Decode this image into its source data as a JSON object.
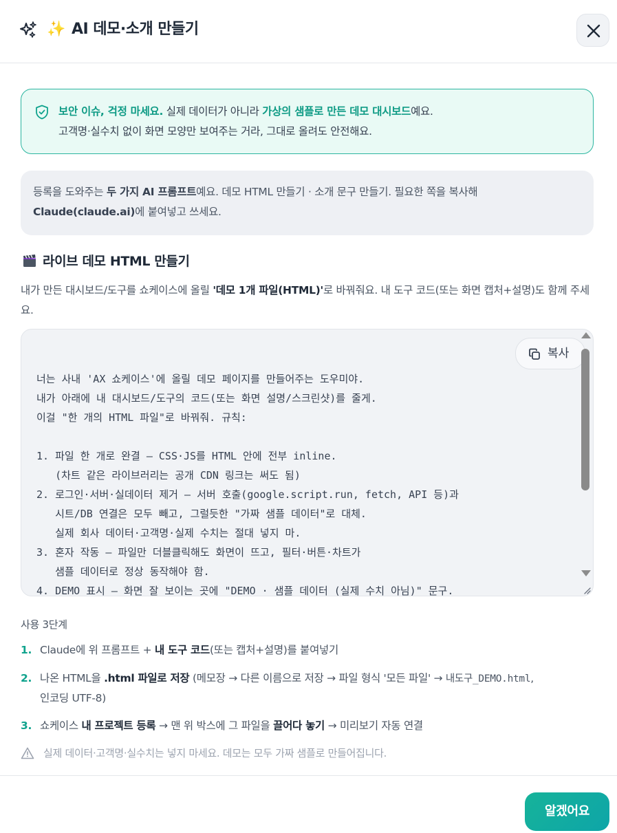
{
  "header": {
    "title": "AI 데모·소개 만들기",
    "emoji": "✨"
  },
  "notice": {
    "bold1": "보안 이슈, 걱정 마세요.",
    "text1": " 실제 데이터가 아니라 ",
    "bold2": "가상의 샘플로 만든 데모 대시보드",
    "text2": "예요.",
    "line2": "고객명·실수치 없이 화면 모양만 보여주는 거라, 그대로 올려도 안전해요."
  },
  "info": {
    "t1": "등록을 도와주는 ",
    "b1": "두 가지 AI 프롬프트",
    "t2": "예요. 데모 HTML 만들기 · 소개 문구 만들기. 필요한 쪽을 복사해",
    "b2": "Claude(claude.ai)",
    "t3": "에 붙여넣고 쓰세요."
  },
  "section": {
    "title": "라이브 데모 HTML 만들기",
    "desc_t1": "내가 만든 대시보드/도구를 쇼케이스에 올릴 ",
    "desc_b1": "'데모 1개 파일(HTML)'",
    "desc_t2": "로 바꿔줘요. 내 도구 코드(또는 화면 캡처+설명)도 함께 주세요."
  },
  "code": {
    "copy_label": "복사",
    "prompt": "너는 사내 'AX 쇼케이스'에 올릴 데모 페이지를 만들어주는 도우미야.\n내가 아래에 내 대시보드/도구의 코드(또는 화면 설명/스크린샷)를 줄게.\n이걸 \"한 개의 HTML 파일\"로 바꿔줘. 규칙:\n\n1. 파일 한 개로 완결 — CSS·JS를 HTML 안에 전부 inline.\n   (차트 같은 라이브러리는 공개 CDN 링크는 써도 됨)\n2. 로그인·서버·실데이터 제거 — 서버 호출(google.script.run, fetch, API 등)과\n   시트/DB 연결은 모두 빼고, 그럴듯한 \"가짜 샘플 데이터\"로 대체.\n   실제 회사 데이터·고객명·실제 수치는 절대 넣지 마.\n3. 혼자 작동 — 파일만 더블클릭해도 화면이 뜨고, 필터·버튼·차트가\n   샘플 데이터로 정상 동작해야 함.\n4. DEMO 표시 — 화면 잘 보이는 곳에 \"DEMO · 샘플 데이터 (실제 수치 아님)\" 문구."
  },
  "steps": {
    "title": "사용 3단계",
    "s1": {
      "num": "1.",
      "t1": "Claude에 위 프롬프트 + ",
      "b1": "내 도구 코드",
      "t2": "(또는 캡처+설명)를 붙여넣기"
    },
    "s2": {
      "num": "2.",
      "t1": "나온 HTML을 ",
      "b1": ".html 파일로 저장",
      "t2": " (메모장 → 다른 이름으로 저장 → 파일 형식 '모든 파일' → ",
      "mono": "내도구_DEMO.html",
      "t3": ",",
      "line2": "인코딩 UTF-8)"
    },
    "s3": {
      "num": "3.",
      "t1": "쇼케이스 ",
      "b1": "내 프로젝트 등록",
      "t2": " → 맨 위 박스에 그 파일을 ",
      "b2": "끌어다 놓기",
      "t3": " → 미리보기 자동 연결"
    }
  },
  "warning": "실제 데이터·고객명·실수치는 넣지 마세요. 데모는 모두 가짜 샘플로 만들어집니다.",
  "footer": {
    "ok_label": "알겠어요"
  },
  "colors": {
    "accent": "#10a38d",
    "notice_bg": "#e9faf5",
    "notice_border": "#2bb5a0"
  }
}
